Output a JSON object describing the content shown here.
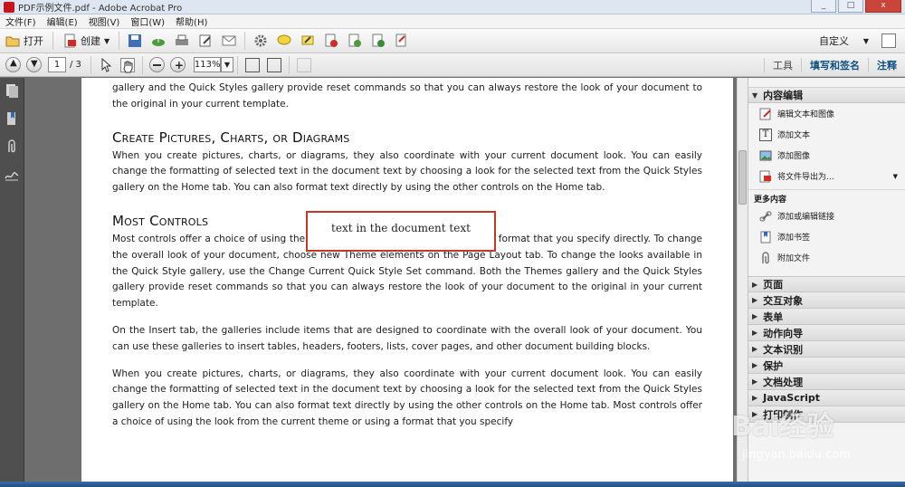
{
  "window": {
    "title": "PDF示例文件.pdf - Adobe Acrobat Pro",
    "controls": [
      "_",
      "□",
      "x"
    ]
  },
  "menu": [
    "文件(F)",
    "编辑(E)",
    "视图(V)",
    "窗口(W)",
    "帮助(H)"
  ],
  "toolbar": {
    "open_label": "打开",
    "create_label": "创建",
    "customize_label": "自定义"
  },
  "navbar": {
    "page_current": "1",
    "page_total": "/ 3",
    "zoom": "113%"
  },
  "right_tools": {
    "tools": "工具",
    "sign": "填写和签名",
    "comment": "注释"
  },
  "document": {
    "para0": "gallery and the Quick Styles gallery provide reset commands so that you can always restore the look of your document to the original in your current template.",
    "heading1": "Create Pictures, Charts, or Diagrams",
    "para1": "When you create pictures, charts, or diagrams, they also coordinate with your current document look. You can easily change the formatting of selected text in the document text by choosing a look for the selected text from the Quick Styles gallery on the Home tab. You can also format text directly by using the other controls on the Home tab.",
    "heading2": "Most Controls",
    "para2": "Most controls offer a choice of using the look from the current theme or using a format that you specify directly. To change the overall look of your document, choose new Theme elements on the Page Layout tab. To change the looks available in the Quick Style gallery, use the Change Current Quick Style Set command. Both the Themes gallery and the Quick Styles gallery provide reset commands so that you can always restore the look of your document to the original in your current template.",
    "para3": "On the Insert tab, the galleries include items that are designed to coordinate with the overall look of your document. You can use these galleries to insert tables, headers, footers, lists, cover pages, and other document building blocks.",
    "para4": "When you create pictures, charts, or diagrams, they also coordinate with your current document look. You can easily change the formatting of selected text in the document text by choosing a look for the selected text from the Quick Styles gallery on the Home tab. You can also format text directly by using the other controls on the Home tab. Most controls offer a choice of using the look from the current theme or using a format that you specify",
    "callout": "text in the document text"
  },
  "panel": {
    "content_edit": "内容编辑",
    "items": [
      "编辑文本和图像",
      "添加文本",
      "添加图像",
      "将文件导出为..."
    ],
    "more_content": "更多内容",
    "more_items": [
      "添加或编辑链接",
      "添加书签",
      "附加文件"
    ],
    "sections": [
      "页面",
      "交互对象",
      "表单",
      "动作向导",
      "文本识别",
      "保护",
      "文档处理",
      "JavaScript",
      "打印制作"
    ]
  },
  "watermark": {
    "brand": "Bai经验",
    "url": "jingyan.baidu.com"
  }
}
